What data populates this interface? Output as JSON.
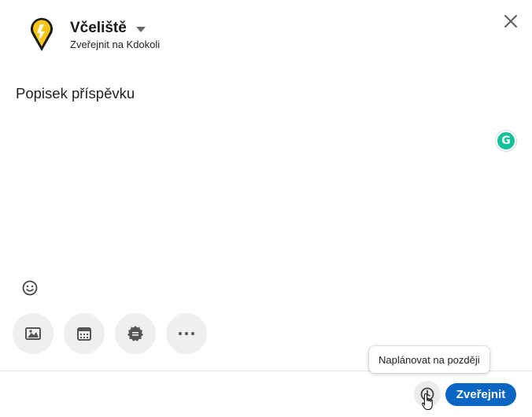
{
  "header": {
    "author_name": "Včeliště",
    "visibility": "Zveřejnit na Kdokoli"
  },
  "editor": {
    "placeholder": "Popisek příspěvku"
  },
  "icons": {
    "logo": "bee-location-pin-logo",
    "close": "close-icon",
    "grammarly": "grammarly-icon",
    "emoji": "emoji-smile-icon",
    "media": "image-icon",
    "event": "calendar-icon",
    "celebrate": "badge-icon",
    "more": "more-dots-icon",
    "schedule": "clock-icon"
  },
  "footer": {
    "tooltip": "Naplánovat na později",
    "publish_label": "Zveřejnit"
  },
  "colors": {
    "accent": "#0a66c2",
    "logo_yellow": "#f5c518",
    "grammarly": "#15c39a"
  }
}
